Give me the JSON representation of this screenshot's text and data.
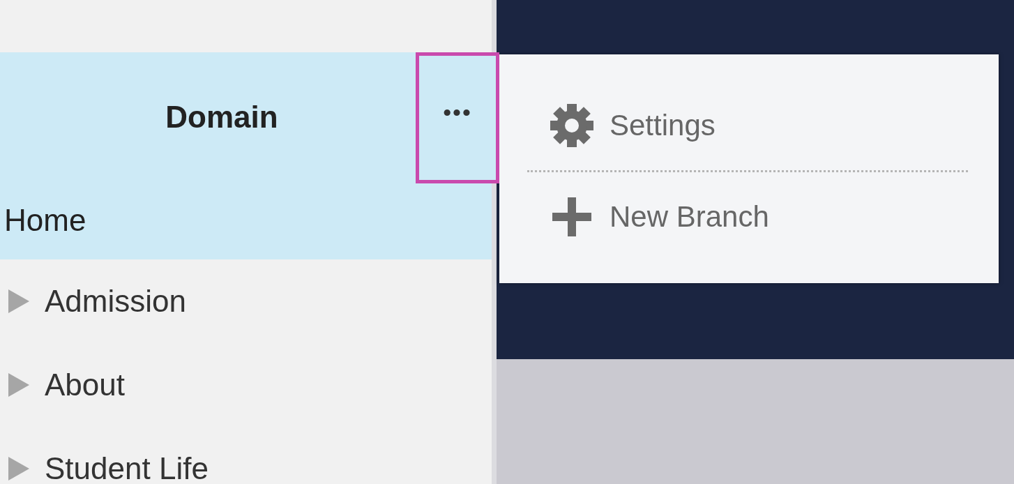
{
  "sidebar": {
    "domain": {
      "label": "Domain",
      "selected": true
    },
    "more_button": "•••",
    "home": {
      "label": "Home",
      "selected": true
    },
    "items": [
      {
        "label": "Admission",
        "expanded": false,
        "selected": false
      },
      {
        "label": "About",
        "expanded": false,
        "selected": false
      },
      {
        "label": "Student Life",
        "expanded": false,
        "selected": false
      }
    ]
  },
  "context_menu": {
    "items": [
      {
        "kind": "settings",
        "label": "Settings"
      },
      {
        "kind": "new",
        "label": "New Branch"
      }
    ]
  }
}
